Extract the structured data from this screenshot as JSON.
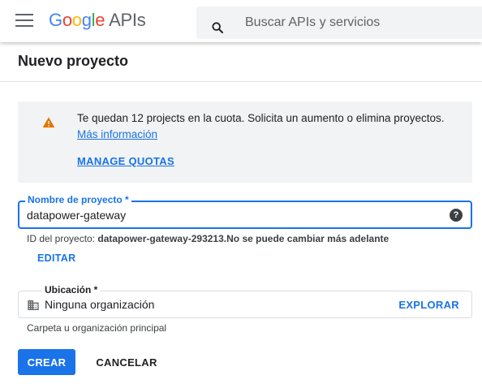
{
  "header": {
    "logo": {
      "g1": "G",
      "o1": "o",
      "o2": "o",
      "g2": "g",
      "l": "l",
      "e": "e",
      "apis": "APIs"
    },
    "search_placeholder": "Buscar APIs y servicios",
    "icons": {
      "menu": "hamburger-menu-icon",
      "search": "search-icon"
    }
  },
  "page": {
    "title": "Nuevo proyecto"
  },
  "quota_notice": {
    "text": "Te quedan 12 projects en la cuota. Solicita un aumento o elimina proyectos.",
    "link": "Más información",
    "action": "MANAGE QUOTAS",
    "icon": "warning-icon",
    "icon_color": "#e37400"
  },
  "project_name": {
    "label": "Nombre de proyecto *",
    "value": "datapower-gateway",
    "help_icon": "help-icon"
  },
  "project_id": {
    "prefix": "ID del proyecto: ",
    "id": "datapower-gateway-293213",
    "suffix": ".No se puede cambiar más adelante",
    "edit": "EDITAR"
  },
  "location": {
    "label": "Ubicación *",
    "value": "Ninguna organización",
    "browse": "EXPLORAR",
    "hint": "Carpeta u organización principal",
    "icon": "building-icon"
  },
  "actions": {
    "create": "CREAR",
    "cancel": "CANCELAR"
  },
  "colors": {
    "accent": "#1a73e8",
    "warning": "#e37400",
    "notice_bg": "#f1f3f4"
  }
}
